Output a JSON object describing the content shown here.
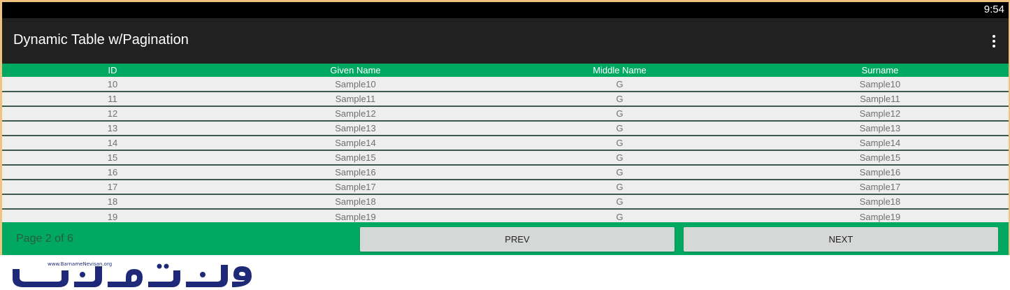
{
  "status_bar": {
    "time": "9:54"
  },
  "app_bar": {
    "title": "Dynamic Table w/Pagination",
    "menu_icon": "overflow-menu-icon"
  },
  "table": {
    "columns": [
      "ID",
      "Given Name",
      "Middle Name",
      "Surname"
    ],
    "rows": [
      [
        "10",
        "Sample10",
        "G",
        "Sample10"
      ],
      [
        "11",
        "Sample11",
        "G",
        "Sample11"
      ],
      [
        "12",
        "Sample12",
        "G",
        "Sample12"
      ],
      [
        "13",
        "Sample13",
        "G",
        "Sample13"
      ],
      [
        "14",
        "Sample14",
        "G",
        "Sample14"
      ],
      [
        "15",
        "Sample15",
        "G",
        "Sample15"
      ],
      [
        "16",
        "Sample16",
        "G",
        "Sample16"
      ],
      [
        "17",
        "Sample17",
        "G",
        "Sample17"
      ],
      [
        "18",
        "Sample18",
        "G",
        "Sample18"
      ],
      [
        "19",
        "Sample19",
        "G",
        "Sample19"
      ]
    ]
  },
  "pagination": {
    "label": "Page 2 of 6",
    "prev_label": "PREV",
    "next_label": "NEXT"
  },
  "watermark": {
    "url": "www.BarnameNevisan.org"
  },
  "colors": {
    "accent": "#00a862",
    "app_bar": "#212121",
    "row_bg": "#eeeeee",
    "frame": "#f1c27d",
    "logo": "#1e2a78"
  }
}
